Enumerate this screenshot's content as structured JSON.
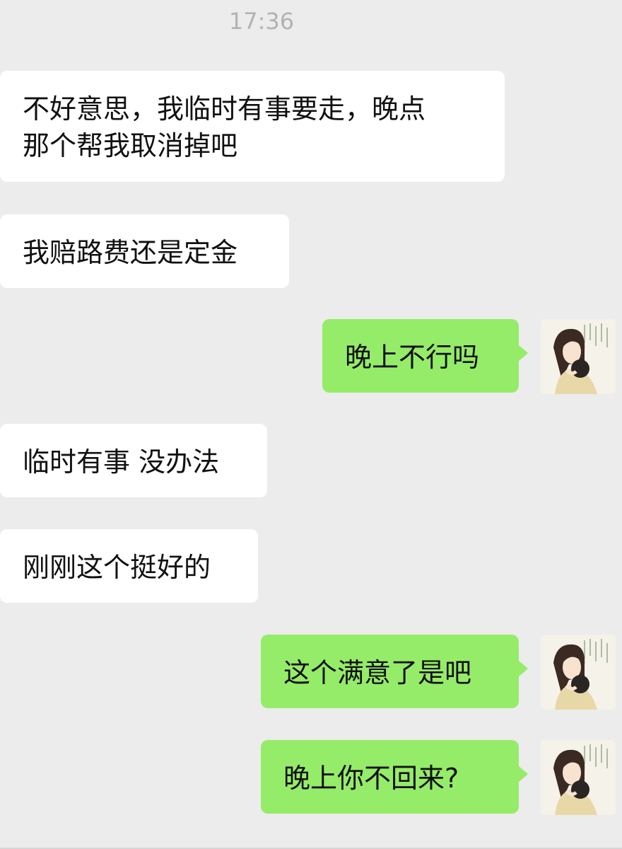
{
  "chat": {
    "timestamp": "17:36",
    "messages": [
      {
        "side": "incoming",
        "text_lines": [
          "不好意思，我临时有事要走，晚点",
          "那个帮我取消掉吧"
        ]
      },
      {
        "side": "incoming",
        "text": "我赔路费还是定金"
      },
      {
        "side": "outgoing",
        "text": "晚上不行吗"
      },
      {
        "side": "incoming",
        "text": "临时有事 没办法"
      },
      {
        "side": "incoming",
        "text": "刚刚这个挺好的"
      },
      {
        "side": "outgoing",
        "text": "这个满意了是吧"
      },
      {
        "side": "outgoing",
        "text": "晚上你不回来?"
      }
    ],
    "colors": {
      "background": "#ececec",
      "incoming_bubble": "#ffffff",
      "outgoing_bubble": "#95ec69",
      "text": "#111111",
      "timestamp": "#b2b2b2"
    },
    "avatar_icon": "user-avatar-icon"
  }
}
